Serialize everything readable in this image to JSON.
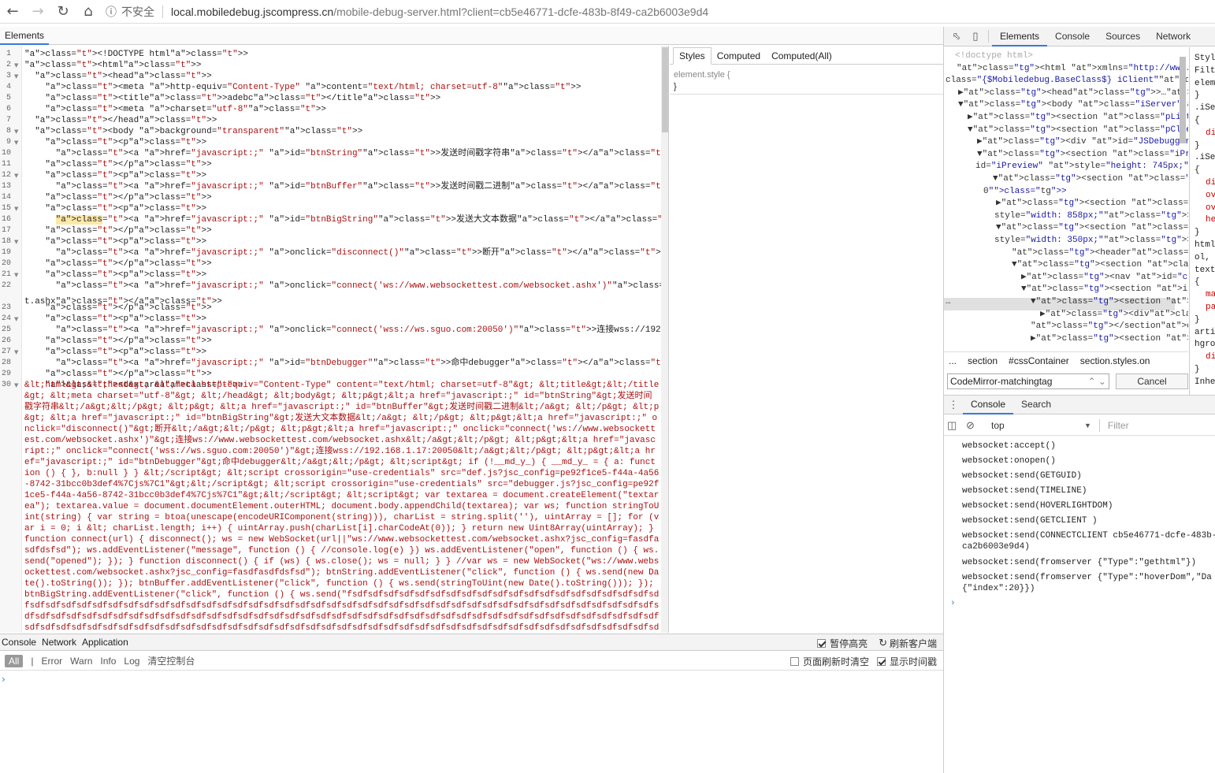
{
  "browser": {
    "insecure": "不安全",
    "url_host": "local.mobiledebug.jscompress.cn",
    "url_path": "/mobile-debug-server.html?client=cb5e46771-dcfe-483b-8f49-ca2b6003e9d4"
  },
  "left": {
    "elements_tab": "Elements",
    "styles_tabs": [
      "Styles",
      "Computed",
      "Computed(All)"
    ],
    "element_style_selector": "element.style {",
    "element_style_close": "}"
  },
  "code": {
    "line_numbers": [
      "1",
      "2",
      "3",
      "4",
      "5",
      "6",
      "7",
      "8",
      "9",
      "10",
      "11",
      "12",
      "13",
      "14",
      "15",
      "16",
      "17",
      "18",
      "19",
      "20",
      "21",
      "22",
      "23",
      "24",
      "25",
      "26",
      "27",
      "28",
      "29",
      "30"
    ],
    "lines": [
      "<!DOCTYPE html>",
      "<html>",
      "  <head>",
      "    <meta http-equiv=\"Content-Type\" content=\"text/html; charset=utf-8\">",
      "    <title>adebc</title>",
      "    <meta charset=\"utf-8\">",
      "  </head>",
      "  <body background=\"transparent\">",
      "    <p>",
      "      <a href=\"javascript:;\" id=\"btnString\">发送时间戳字符串</a>",
      "    </p>",
      "    <p>",
      "      <a href=\"javascript:;\" id=\"btnBuffer\">发送时间戳二进制</a>",
      "    </p>",
      "    <p>",
      "      <a href=\"javascript:;\" id=\"btnBigString\">发送大文本数据</a>",
      "    </p>",
      "    <p>",
      "      <a href=\"javascript:;\" onclick=\"disconnect()\">断开</a>",
      "    </p>",
      "    <p>",
      "      <a href=\"javascript:;\" onclick=\"connect('ws://www.websockettest.com/websocket.ashx')\">连接ws://www.websockettest.com/websocke",
      "t.ashx</a>",
      "    </p>",
      "    <p>",
      "      <a href=\"javascript:;\" onclick=\"connect('wss://ws.sguo.com:20050')\">连接wss://192.168.1.17:20050</a>",
      "    </p>",
      "    <p>",
      "      <a href=\"javascript:;\" id=\"btnDebugger\">命中debugger</a>",
      "    </p>",
      "    <textarea>"
    ],
    "textarea_content": "&lt;html&gt;&lt;head&gt; &lt;meta http-equiv=\"Content-Type\" content=\"text/html; charset=utf-8\"&gt; &lt;title&gt;&lt;/title&gt; &lt;meta charset=\"utf-8\"&gt; &lt;/head&gt; &lt;body&gt; &lt;p&gt;&lt;a href=\"javascript:;\" id=\"btnString\"&gt;发送时间戳字符串&lt;/a&gt;&lt;/p&gt; &lt;p&gt; &lt;a href=\"javascript:;\" id=\"btnBuffer\"&gt;发送时间戳二进制&lt;/a&gt; &lt;/p&gt; &lt;p&gt; &lt;a href=\"javascript:;\" id=\"btnBigString\"&gt;发送大文本数据&lt;/a&gt; &lt;/p&gt; &lt;p&gt;&lt;a href=\"javascript:;\" onclick=\"disconnect()\"&gt;断开&lt;/a&gt;&lt;/p&gt; &lt;p&gt;&lt;a href=\"javascript:;\" onclick=\"connect('ws://www.websockettest.com/websocket.ashx')\"&gt;连接ws://www.websockettest.com/websocket.ashx&lt;/a&gt;&lt;/p&gt; &lt;p&gt;&lt;a href=\"javascript:;\" onclick=\"connect('wss://ws.sguo.com:20050')\"&gt;连接wss://192.168.1.17:20050&lt;/a&gt;&lt;/p&gt; &lt;p&gt;&lt;a href=\"javascript:;\" id=\"btnDebugger\"&gt;命中debugger&lt;/a&gt;&lt;/p&gt; &lt;script&gt; if (!__md_y_) { __md_y_ = { a: function () { }, b:null } } &lt;/script&gt; &lt;script crossorigin=\"use-credentials\" src=\"def.js?jsc_config=pe92f1ce5-f44a-4a56-8742-31bcc0b3def4%7Cjs%7C1\"&gt;&lt;/script&gt; &lt;script crossorigin=\"use-credentials\" src=\"debugger.js?jsc_config=pe92f1ce5-f44a-4a56-8742-31bcc0b3def4%7Cjs%7C1\"&gt;&lt;/script&gt; &lt;script&gt; var textarea = document.createElement(\"textarea\"); textarea.value = document.documentElement.outerHTML; document.body.appendChild(textarea); var ws; function stringToUint(string) { var string = btoa(unescape(encodeURIComponent(string))), charList = string.split(''), uintArray = []; for (var i = 0; i &lt; charList.length; i++) { uintArray.push(charList[i].charCodeAt(0)); } return new Uint8Array(uintArray); } function connect(url) { disconnect(); ws = new WebSocket(url||\"ws://www.websockettest.com/websocket.ashx?jsc_config=fasdfasdfdsfsd\"); ws.addEventListener(\"message\", function () { //console.log(e) }) ws.addEventListener(\"open\", function () { ws.send(\"opened\"); }); } function disconnect() { if (ws) { ws.close(); ws = null; } } //var ws = new WebSocket(\"ws://www.websockettest.com/websocket.ashx?jsc_config=fasdfasdfdsfsd\"); btnString.addEventListener(\"click\", function () { ws.send(new Date().toString()); }); btnBuffer.addEventListener(\"click\", function () { ws.send(stringToUint(new Date().toString())); }); btnBigString.addEventListener(\"click\", function () { ws.send(\"fsdfsdfsdfsdfsdfsdfsdfsdfsdfsdfsdfsdfsdfsdfsdfsdfsdfsdfsdfsdfsdfsdfsdfsdfsdfsdfsdfsdfsdfsdfsdfsdfsdfsdfsdfsdfsdfsdfsdfsdfsdfsdfsdfsdfsdfsdfsdfsdfsdfsdfsdfsdfsdfsdfsdfsdfsdfsdfsdfsdfsdfsdfsdfsdfsdfsdfsdfsdfsdfsdfsdfsdfsdfsdfsdfsdfsdfsdfsdfsdfsdfsdfsdfsdfsdfsdfsdfsdfsdfsdfsdfsdfsdfsdfsdfsdfsdfsdfsdfsdfsdfsdfsdfsdfsdfsdfsdfsdfsdfsdfsdfsdfsdfsdfsdfsdfsdfsdfsdfsdfsdfsdfsdfsdfsdfsdfsdfsdfsdfsdfsdfsdfsdfsdfsdfsdfsdfsdfsdfsdfsdfsdfsdfsdfsdfsdfsdfsdfsdfsdfsdfsdfsdfsdfsdfsdfsdfsdfsdfsdfsdfsdfsdfsdfsdfsdfsdfsdfsdfsdfsdfsdfsdfsdfsdfsdfsdfsdfsdfsdfsdfsdfsdfsdfsdfsdfsdfsdfsdfsdfsdfsdfsdfsdfsdfsdfsdfsdfsdfsdfsdfsdfsdfsdfsdfsdfsdfsdfsdfsdfsdfsdfsdfsdfsdfsdfsdfsdfsdfsdfsdfsdfsdfsdfsdfsdfsdfsdfsdfsdfsdfsdfsdfsdfsdfsdfsdfsdfsdfsdfsdfsdfsdfsdfsdfsdfsdfsdfsdfsdfsdfsdfsdfsdfsdfsdfsdfsdfsdfsdfsdfsdfsdfsdfsdfsdfsdfsdfsdfsdfsdfsdfsdfsdfsdfsdfsdfsdfsdfsdfsdfsdfsdfsdfsdfsdfsdfsdfsdfsdfsdfsdfsdfsdfsdfsdfsdfsdfsdfsdfsdfsdfsdfsdfsdfsdfsdfsdfsdfsdfsdfsdfsdfsdfsdfsdfsdfsdfsdfsdfsdfsdfsdfsdfsdfsdfsdfsdfsdfsdfsdfs"
  },
  "bottom": {
    "tabs": [
      "Console",
      "Network",
      "Application"
    ],
    "pause_highlight": "暂停高亮",
    "refresh_client": "刷新客户端",
    "levels": [
      "All",
      "|",
      "Error",
      "Warn",
      "Info",
      "Log",
      "清空控制台"
    ],
    "clear_on_refresh": "页面刷新时清空",
    "show_timestamp": "显示时间戳",
    "prompt": "›"
  },
  "right": {
    "tabs": [
      "Elements",
      "Console",
      "Sources",
      "Network"
    ],
    "dom": [
      {
        "t": "<!doctype html>"
      },
      {
        "t": "<html xmlns=\"http://www.w3.org/1999/xhtml\""
      },
      {
        "t": "class=\"{$Mobiledebug.BaseClass$} iClient\">"
      },
      {
        "t": "▶<head>…</head>"
      },
      {
        "t": "▼<body class=\"iServer\">"
      },
      {
        "t": "▶<section class=\"pList\">…</section>"
      },
      {
        "t": "▼<section class=\"pClient\">"
      },
      {
        "t": "▶<div id=\"JSDebugger\">…</div>"
      },
      {
        "t": "▼<section class=\"iPreview notSelect\""
      },
      {
        "t": "id=\"iPreview\" style=\"height: 745px;\">"
      },
      {
        "t": "▼<section class=\"box on\" id=\"etab-"
      },
      {
        "t": "0\">"
      },
      {
        "t": "▶<section class=\"iHtml\" id=\"iHtml\""
      },
      {
        "t": "style=\"width: 858px;\">…</section>"
      },
      {
        "t": "▼<section class=\"iCss\" id=\"iCss\""
      },
      {
        "t": "style=\"width: 350px;\">"
      },
      {
        "t": "<header></header>"
      },
      {
        "t": "▼<section class=\"body\">"
      },
      {
        "t": "▶<nav id=\"cssSelector\">…</nav>"
      },
      {
        "t": "▼<section id=\"cssContainer\">"
      },
      {
        "t": "▼<section class=\"styles on\">"
      },
      {
        "t": "▶<div>…</div>"
      },
      {
        "t": "</section>"
      },
      {
        "t": "▶<section class=\"custom"
      }
    ],
    "side": [
      "Style",
      "Filte",
      "eleme",
      "}",
      ".iSe",
      "{",
      "di",
      "}",
      ".iSe",
      "{",
      "di",
      "ov",
      "ov",
      "he",
      "}",
      "html",
      "ol, ",
      "text",
      "{",
      "ma",
      "pa",
      "}",
      "artic",
      "hgrou",
      "di",
      "}",
      "Inher"
    ],
    "crumbs": [
      "...",
      "section",
      "#cssContainer",
      "section.styles.on"
    ],
    "find_value": "CodeMirror-matchingtag",
    "cancel": "Cancel",
    "drawer_tabs": [
      "Console",
      "Search"
    ],
    "context": "top",
    "filter_placeholder": "Filter",
    "log": [
      "websocket:accept()",
      "websocket:onopen()",
      "websocket:send(GETGUID)",
      "websocket:send(TIMELINE)",
      "websocket:send(HOVERLIGHTDOM)",
      "websocket:send(GETCLIENT )",
      "websocket:send(CONNECTCLIENT cb5e46771-dcfe-483b-\nca2b6003e9d4)",
      "websocket:send(fromserver {\"Type\":\"gethtml\"})",
      "websocket:send(fromserver {\"Type\":\"hoverDom\",\"Da\n{\"index\":20}})"
    ],
    "prompt": "›"
  }
}
